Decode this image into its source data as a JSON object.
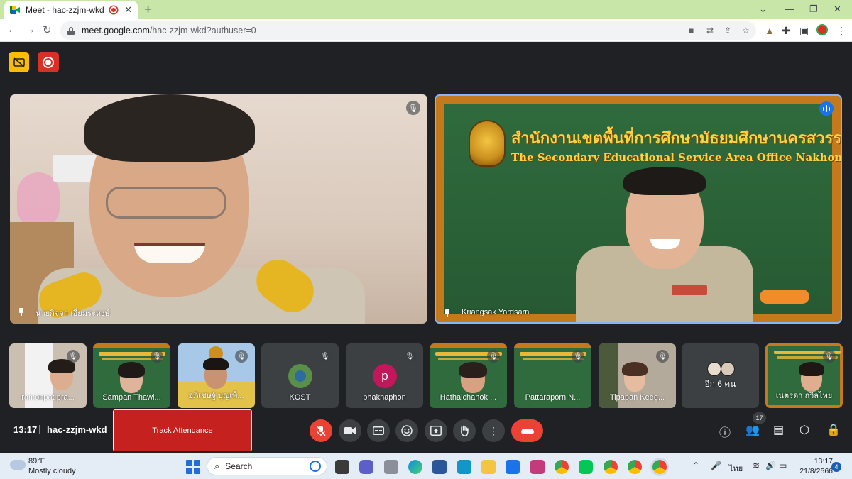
{
  "browser": {
    "tab_title": "Meet - hac-zzjm-wkd",
    "tab_close": "✕",
    "new_tab": "+",
    "url_host": "meet.google.com",
    "url_path": "/hac-zzjm-wkd?authuser=0",
    "window_controls": [
      "⌄",
      "—",
      "❐",
      "✕"
    ]
  },
  "meet": {
    "main_tiles": [
      {
        "name": "นายกิจจา เอี่ยมระหงษ์",
        "muted": true
      },
      {
        "name": "Kriangsak Yordsarn",
        "speaking": true
      }
    ],
    "board": {
      "title_th": "สำนักงานเขตพื้นที่การศึกษามัธยมศึกษานครสวรรค์",
      "title_en": "The Secondary Educational Service Area Office Nakhon Sawan"
    },
    "participants": [
      {
        "name": "ramonpat pra..."
      },
      {
        "name": "Sampan Thawi..."
      },
      {
        "name": "อภิเชษฐ์ บุญเพ็..."
      },
      {
        "name": "KOST"
      },
      {
        "name": "phakhaphon",
        "avatar_letter": "p"
      },
      {
        "name": "Hathaichanok ..."
      },
      {
        "name": "Pattaraporn N..."
      },
      {
        "name": "Tipapan Keeg..."
      },
      {
        "name": "อีก 6 คน"
      },
      {
        "name": "เนตรดา ถวิลไทย"
      }
    ],
    "meeting_time": "13:17",
    "separator": "|",
    "meeting_code": "hac-zzjm-wkd",
    "track_attendance_label": "Track Attendance",
    "people_count": "17",
    "colors": {
      "accent": "#1a73e8",
      "danger": "#ea4335",
      "record": "#d93025",
      "badge_yellow": "#fbbc04"
    }
  },
  "taskbar": {
    "temperature": "89°F",
    "weather": "Mostly cloudy",
    "search_label": "Search",
    "language": "ไทย",
    "time": "13:17",
    "date": "21/8/2566",
    "notifications": "4"
  }
}
